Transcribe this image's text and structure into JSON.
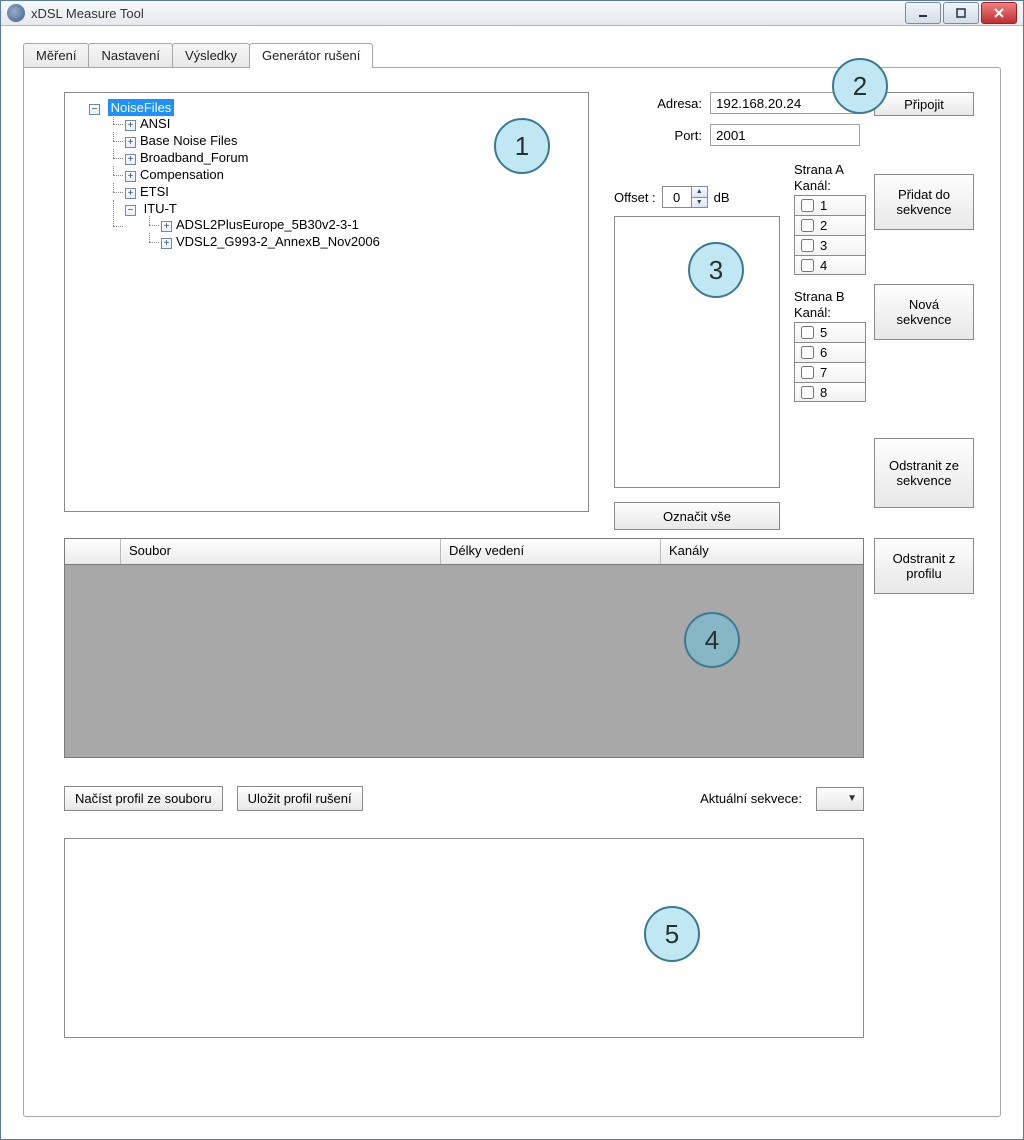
{
  "window": {
    "title": "xDSL Measure Tool"
  },
  "tabs": [
    "Měření",
    "Nastavení",
    "Výsledky",
    "Generátor rušení"
  ],
  "active_tab_index": 3,
  "tree": {
    "root": "NoiseFiles",
    "items": [
      "ANSI",
      "Base Noise Files",
      "Broadband_Forum",
      "Compensation",
      "ETSI"
    ],
    "itu": {
      "label": "ITU-T",
      "children": [
        "ADSL2PlusEurope_5B30v2-3-1",
        "VDSL2_G993-2_AnnexB_Nov2006"
      ]
    }
  },
  "connection": {
    "address_label": "Adresa:",
    "address_value": "192.168.20.24",
    "port_label": "Port:",
    "port_value": "2001",
    "connect": "Připojit"
  },
  "offset": {
    "label": "Offset :",
    "value": "0",
    "unit": "dB"
  },
  "channels": {
    "groupA": {
      "title": "Strana A Kanál:",
      "items": [
        "1",
        "2",
        "3",
        "4"
      ]
    },
    "groupB": {
      "title": "Strana B Kanál:",
      "items": [
        "5",
        "6",
        "7",
        "8"
      ]
    }
  },
  "buttons": {
    "select_all": "Označit vše",
    "add_seq": "Přidat do sekvence",
    "new_seq": "Nová sekvence",
    "rem_seq": "Odstranit ze sekvence",
    "rem_prof": "Odstranit z profilu",
    "load_profile": "Načíst profil ze souboru",
    "save_profile": "Uložit profil rušení"
  },
  "grid": {
    "columns": [
      "Soubor",
      "Délky vedení",
      "Kanály"
    ]
  },
  "sequence": {
    "label": "Aktuální sekvece:"
  },
  "callouts": {
    "1": "1",
    "2": "2",
    "3": "3",
    "4": "4",
    "5": "5"
  }
}
